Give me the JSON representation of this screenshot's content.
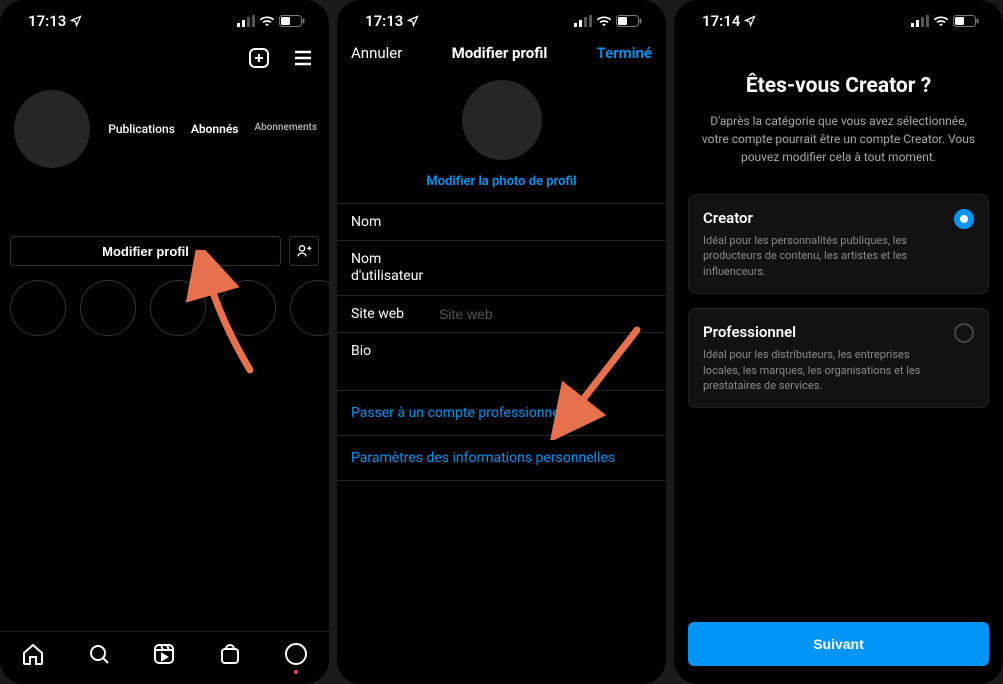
{
  "status": {
    "time1": "17:13",
    "time2": "17:13",
    "time3": "17:14"
  },
  "screen1": {
    "stats": {
      "publications": "Publications",
      "abonnes": "Abonnés",
      "abonnements": "Abonnements"
    },
    "edit_profile": "Modifier profil"
  },
  "screen2": {
    "cancel": "Annuler",
    "title": "Modifier profil",
    "done": "Terminé",
    "change_photo": "Modifier la photo de profil",
    "fields": {
      "name_label": "Nom",
      "username_label": "Nom d'utilisateur",
      "website_label": "Site web",
      "website_placeholder": "Site web",
      "bio_label": "Bio"
    },
    "link_professional": "Passer à un compte professionnel",
    "link_personal": "Paramètres des informations personnelles"
  },
  "screen3": {
    "title": "Êtes-vous Creator ?",
    "subtitle": "D'après la catégorie que vous avez sélectionnée, votre compte pourrait être un compte Creator. Vous pouvez modifier cela à tout moment.",
    "opt1_title": "Creator",
    "opt1_desc": "Idéal pour les personnalités publiques, les producteurs de contenu, les artistes et les influenceurs.",
    "opt2_title": "Professionnel",
    "opt2_desc": "Idéal pour les distributeurs, les entreprises locales, les marques, les organisations et les prestataires de services.",
    "next": "Suivant"
  }
}
